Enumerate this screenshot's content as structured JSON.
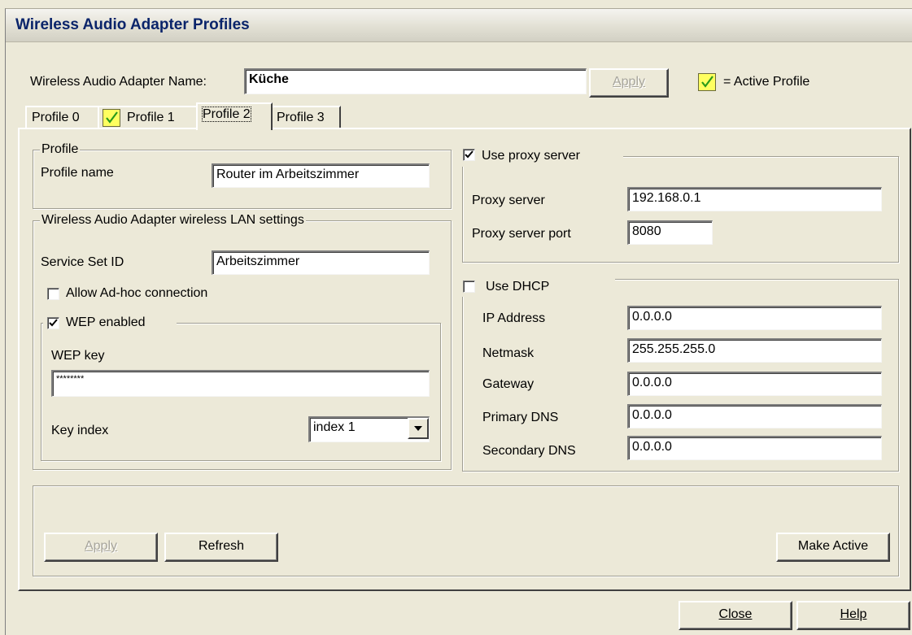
{
  "window": {
    "title": "Wireless Audio Adapter Profiles"
  },
  "header": {
    "adapter_name_label": "Wireless Audio Adapter Name:",
    "adapter_name_value": "Küche",
    "apply_label": "Apply",
    "active_legend": "= Active Profile"
  },
  "tabs": [
    {
      "label": "Profile 0",
      "active_profile": false,
      "selected": false
    },
    {
      "label": "Profile 1",
      "active_profile": true,
      "selected": false
    },
    {
      "label": "Profile 2",
      "active_profile": false,
      "selected": true
    },
    {
      "label": "Profile 3",
      "active_profile": false,
      "selected": false
    }
  ],
  "profile": {
    "group_title": "Profile",
    "name_label": "Profile name",
    "name_value": "Router im Arbeitszimmer"
  },
  "wlan": {
    "group_title": "Wireless Audio Adapter wireless LAN settings",
    "ssid_label": "Service Set ID",
    "ssid_value": "Arbeitszimmer",
    "adhoc_label": "Allow Ad-hoc connection",
    "adhoc_checked": false,
    "wep_label": "WEP enabled",
    "wep_checked": true,
    "wep_key_label": "WEP key",
    "wep_key_value": "********",
    "key_index_label": "Key index",
    "key_index_value": "index 1"
  },
  "proxy": {
    "use_label": "Use proxy server",
    "use_checked": true,
    "server_label": "Proxy server",
    "server_value": "192.168.0.1",
    "port_label": "Proxy server port",
    "port_value": "8080"
  },
  "dhcp": {
    "use_label": "Use DHCP",
    "use_checked": false,
    "ip_label": "IP Address",
    "ip_value": "0.0.0.0",
    "netmask_label": "Netmask",
    "netmask_value": "255.255.255.0",
    "gateway_label": "Gateway",
    "gateway_value": "0.0.0.0",
    "dns1_label": "Primary DNS",
    "dns1_value": "0.0.0.0",
    "dns2_label": "Secondary DNS",
    "dns2_value": "0.0.0.0"
  },
  "actions": {
    "apply_label": "Apply",
    "refresh_label": "Refresh",
    "make_active_label": "Make Active"
  },
  "footer": {
    "close_label": "Close",
    "help_label": "Help"
  },
  "colors": {
    "active_check_bg": "#ffff60",
    "active_check_mark": "#2a9a1a",
    "title_text": "#0a246a"
  }
}
